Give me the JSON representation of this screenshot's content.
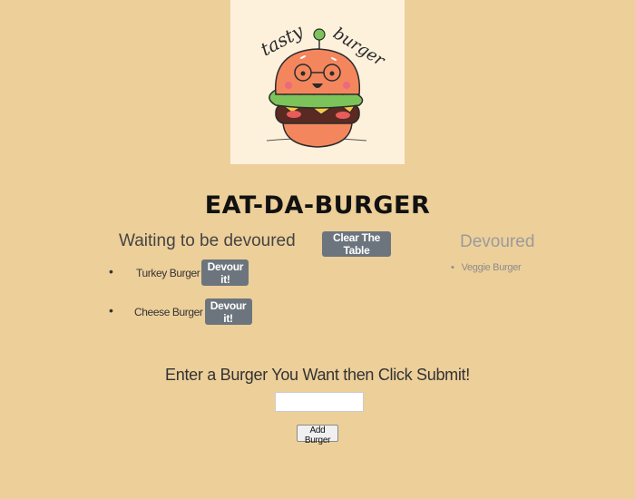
{
  "header": {
    "logo_text_left": "tasty",
    "logo_text_right": "burger",
    "title": "EAT-DA-BURGER"
  },
  "waiting": {
    "heading": "Waiting to be devoured",
    "items": [
      {
        "name": "Turkey Burger",
        "button_label": "Devour it!"
      },
      {
        "name": "Cheese Burger",
        "button_label": "Devour it!"
      }
    ]
  },
  "toolbar": {
    "clear_label": "Clear The Table"
  },
  "devoured": {
    "heading": "Devoured",
    "items": [
      {
        "name": "Veggie Burger"
      }
    ]
  },
  "form": {
    "prompt": "Enter a Burger You Want then Click Submit!",
    "input_value": "",
    "submit_label": "Add Burger"
  },
  "colors": {
    "background": "#EDCF9A",
    "logo_background": "#FEF1DC",
    "button": "#6C757D",
    "bun": "#F4865E",
    "lettuce": "#7CC35A",
    "patty": "#5A2A22"
  }
}
